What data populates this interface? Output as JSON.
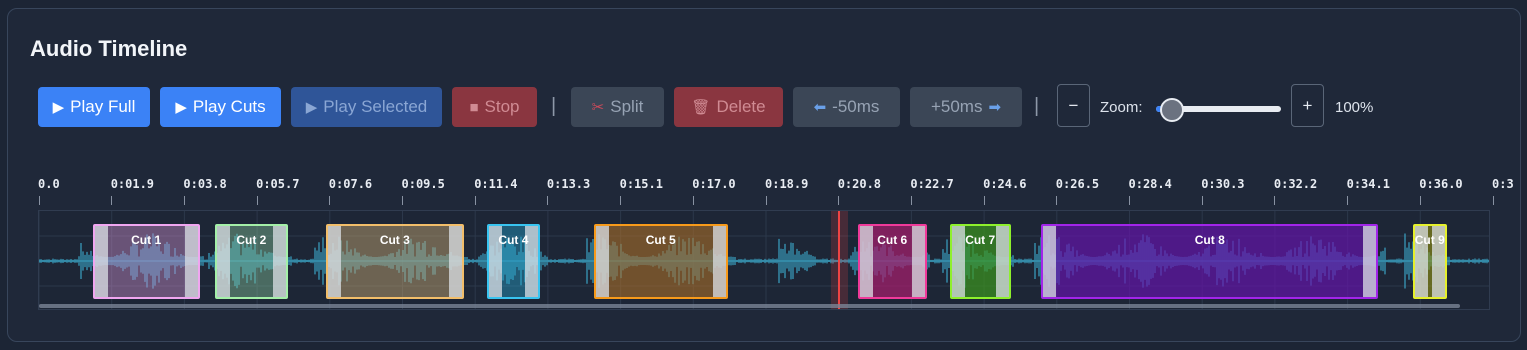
{
  "panel": {
    "title": "Audio Timeline"
  },
  "toolbar": {
    "play_full": {
      "icon": "play-icon",
      "glyph": "▶",
      "label": "Play Full",
      "enabled": true
    },
    "play_cuts": {
      "icon": "play-icon",
      "glyph": "▶",
      "label": "Play Cuts",
      "enabled": true
    },
    "play_selected": {
      "icon": "play-icon",
      "glyph": "▶",
      "label": "Play Selected",
      "enabled": false
    },
    "stop": {
      "icon": "stop-icon",
      "glyph": "■",
      "label": "Stop",
      "enabled": false
    },
    "separator": "|",
    "split": {
      "icon": "scissors-icon",
      "glyph": "✂",
      "label": "Split",
      "enabled": false
    },
    "delete": {
      "icon": "trash-icon",
      "glyph": "🗑",
      "label": "Delete",
      "enabled": false
    },
    "nudge_back": {
      "icon": "arrow-left-icon",
      "glyph": "⬅",
      "label": "-50ms",
      "enabled": false
    },
    "nudge_forward": {
      "icon": "arrow-right-icon",
      "glyph": "➡",
      "label": "+50ms",
      "enabled": false
    }
  },
  "zoom": {
    "minus_label": "−",
    "plus_label": "+",
    "label": "Zoom:",
    "value_text": "100%",
    "slider_fraction": 0.0
  },
  "ruler": {
    "ticks": [
      "0.0",
      "0:01.9",
      "0:03.8",
      "0:05.7",
      "0:07.6",
      "0:09.5",
      "0:11.4",
      "0:13.3",
      "0:15.1",
      "0:17.0",
      "0:18.9",
      "0:20.8",
      "0:22.7",
      "0:24.6",
      "0:26.5",
      "0:28.4",
      "0:30.3",
      "0:32.2",
      "0:34.1",
      "0:36.0",
      "0:3"
    ]
  },
  "colors": {
    "accent": "#3b82f6",
    "playhead": "#ef4444",
    "waveform": "#3aa3c4"
  },
  "timeline": {
    "playhead_time": 20.9,
    "cuts": [
      {
        "label": "Cut 1",
        "start": 1.4,
        "end": 4.2,
        "color": "#f0a6f0",
        "fill": "rgba(200,140,200,0.45)"
      },
      {
        "label": "Cut 2",
        "start": 4.6,
        "end": 6.5,
        "color": "#a4f0a8",
        "fill": "rgba(130,190,150,0.45)"
      },
      {
        "label": "Cut 3",
        "start": 7.5,
        "end": 11.1,
        "color": "#f2be6a",
        "fill": "rgba(190,160,110,0.5)"
      },
      {
        "label": "Cut 4",
        "start": 11.7,
        "end": 13.1,
        "color": "#38c4f0",
        "fill": "rgba(40,160,200,0.45)"
      },
      {
        "label": "Cut 5",
        "start": 14.5,
        "end": 18.0,
        "color": "#f79a1a",
        "fill": "rgba(170,110,40,0.6)"
      },
      {
        "label": "Cut 6",
        "start": 21.4,
        "end": 23.2,
        "color": "#f03a9a",
        "fill": "rgba(170,30,110,0.7)"
      },
      {
        "label": "Cut 7",
        "start": 23.8,
        "end": 25.4,
        "color": "#8ef02c",
        "fill": "rgba(60,150,30,0.7)"
      },
      {
        "label": "Cut 8",
        "start": 26.2,
        "end": 35.0,
        "color": "#a225ea",
        "fill": "rgba(100,20,170,0.7)"
      },
      {
        "label": "Cut 9",
        "start": 35.9,
        "end": 36.8,
        "color": "#e5f02c",
        "fill": "rgba(150,150,20,0.6)"
      }
    ]
  }
}
